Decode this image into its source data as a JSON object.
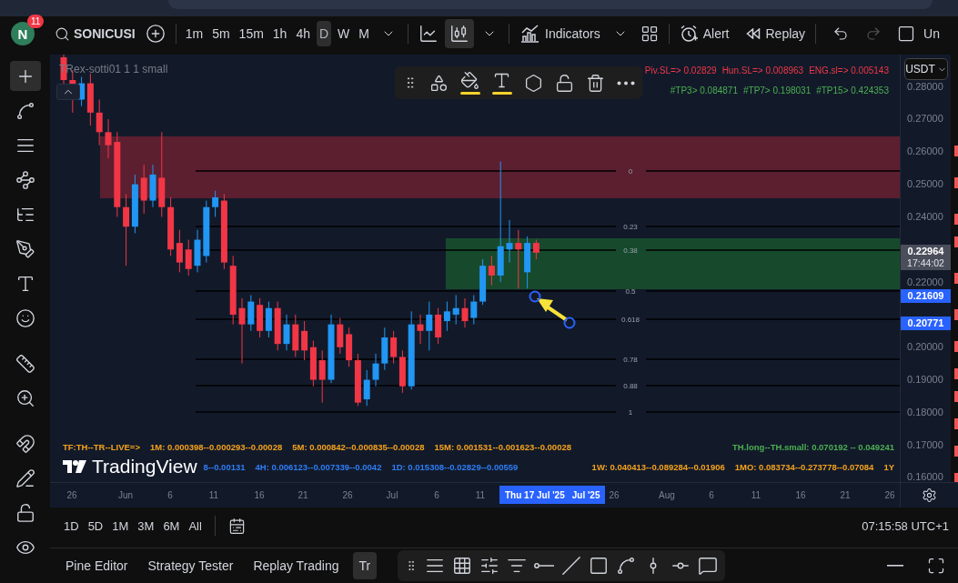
{
  "toolbar": {
    "avatar": "N",
    "badge": "11",
    "symbol": "SONICUSI",
    "intervals": [
      {
        "label": "1m",
        "selected": false
      },
      {
        "label": "5m",
        "selected": false
      },
      {
        "label": "15m",
        "selected": false
      },
      {
        "label": "1h",
        "selected": false
      },
      {
        "label": "4h",
        "selected": false
      },
      {
        "label": "D",
        "selected": true
      },
      {
        "label": "W",
        "selected": false
      },
      {
        "label": "M",
        "selected": false
      }
    ],
    "chart_types": [
      {
        "kind": "line",
        "selected": false
      },
      {
        "kind": "candles",
        "selected": true
      }
    ],
    "indicators": "Indicators",
    "alert": "Alert",
    "replay": "Replay",
    "cut_label": "Un"
  },
  "left_tools": [
    {
      "kind": "crosshair",
      "selected": true
    },
    {
      "kind": "trend-line",
      "selected": false
    },
    {
      "kind": "horizontal-lines",
      "selected": false
    },
    {
      "kind": "pattern",
      "selected": false
    },
    {
      "kind": "fib",
      "selected": false
    },
    {
      "kind": "brush",
      "selected": false
    },
    {
      "kind": "text",
      "selected": false
    },
    {
      "kind": "smiley",
      "selected": false
    },
    {
      "kind": "ruler",
      "selected": false
    },
    {
      "kind": "zoom",
      "selected": false
    },
    {
      "kind": "magnet",
      "selected": false
    },
    {
      "kind": "pencil-lock",
      "selected": false
    },
    {
      "kind": "lock",
      "selected": false
    },
    {
      "kind": "eye",
      "selected": false
    }
  ],
  "chart": {
    "indicator_title": "TRex-sotti01 1 1 small",
    "stop_levels": [
      "Piv.SL=> 0.02829",
      "Hun.SL=> 0.008963",
      "ENG.sl=> 0.005143"
    ],
    "targets": [
      "#TP3> 0.084871",
      "#TP7> 0.198031",
      "#TP15> 0.424353"
    ],
    "drawing_tools": [
      {
        "kind": "drag"
      },
      {
        "kind": "template"
      },
      {
        "kind": "fill",
        "color": "#f7d22a"
      },
      {
        "kind": "text",
        "color": "#f7d22a"
      },
      {
        "kind": "settings"
      },
      {
        "kind": "lock"
      },
      {
        "kind": "delete"
      },
      {
        "kind": "more"
      }
    ],
    "fib_levels": [
      "0",
      "0.23",
      "0.38",
      "0.5",
      "0.618",
      "0.78",
      "0.88",
      "1"
    ],
    "info_rows": [
      {
        "left": [
          {
            "text": "TF:TH--TR--LIVE=>",
            "color": "#f7a21b"
          },
          {
            "text": "1M: 0.000398--0.000293--0.00028",
            "color": "#f7a21b"
          },
          {
            "text": "5M: 0.000842--0.000835--0.00028",
            "color": "#f7a21b"
          },
          {
            "text": "15M: 0.001531--0.001623--0.00028",
            "color": "#f7a21b"
          }
        ],
        "right": [
          {
            "text": "TH.long--TH.small: 0.070192 -- 0.049241",
            "color": "#4caf50"
          }
        ]
      },
      {
        "left": [
          {
            "text": "8--0.00131",
            "color": "#2f7df6"
          },
          {
            "text": "4H: 0.006123--0.007339--0.0042",
            "color": "#2f7df6"
          },
          {
            "text": "1D: 0.015308--0.02829--0.00559",
            "color": "#2f7df6"
          }
        ],
        "right": [
          {
            "text": "1W: 0.040413--0.089284--0.01906",
            "color": "#f7a21b"
          },
          {
            "text": "1MO: 0.083734--0.273778--0.07084",
            "color": "#f7a21b"
          },
          {
            "text": "1Y",
            "color": "#f7a21b"
          }
        ]
      }
    ],
    "logo": "TradingView"
  },
  "price_axis": {
    "currency": "USDT",
    "labels": [
      "0.28000",
      "0.27000",
      "0.26000",
      "0.25000",
      "0.24000",
      "0.22000",
      "0.20000",
      "0.19000",
      "0.18000",
      "0.17000",
      "0.16000"
    ],
    "last_price": "0.22964",
    "countdown": "17:44:02",
    "markers": [
      "0.21609",
      "0.20771"
    ]
  },
  "time_axis": {
    "labels": [
      "26",
      "Jun",
      "6",
      "11",
      "16",
      "21",
      "26",
      "Jul",
      "6",
      "11",
      "26",
      "Aug",
      "6",
      "11",
      "16",
      "21",
      "26"
    ],
    "cursor_date": "Thu 17 Jul '25",
    "cursor_month": "Jul '25"
  },
  "range_bar": {
    "ranges": [
      "1D",
      "5D",
      "1M",
      "3M",
      "6M",
      "All"
    ],
    "clock": "07:15:58 UTC+1"
  },
  "bottom_panel": {
    "tabs": [
      {
        "label": "Pine Editor",
        "selected": false
      },
      {
        "label": "Strategy Tester",
        "selected": false
      },
      {
        "label": "Replay Trading",
        "selected": false
      },
      {
        "label": "Tr",
        "selected": true
      }
    ],
    "tools": [
      {
        "kind": "drag"
      },
      {
        "kind": "lines"
      },
      {
        "kind": "grid"
      },
      {
        "kind": "channel"
      },
      {
        "kind": "fib"
      },
      {
        "kind": "ray"
      },
      {
        "kind": "trend-line"
      },
      {
        "kind": "rectangle"
      },
      {
        "kind": "path"
      },
      {
        "kind": "vertical-line"
      },
      {
        "kind": "horizontal-line"
      },
      {
        "kind": "callout"
      }
    ]
  }
}
